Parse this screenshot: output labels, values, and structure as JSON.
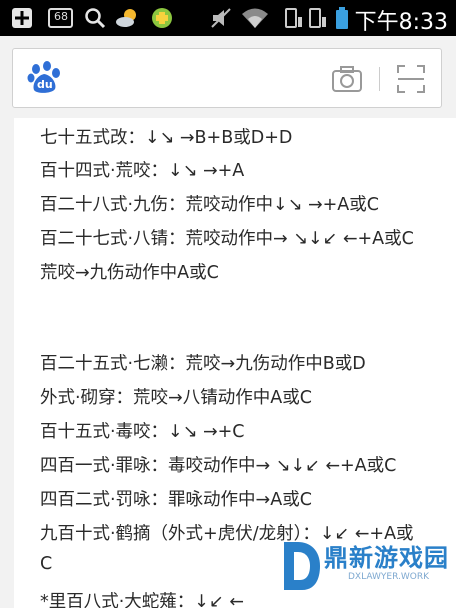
{
  "status_bar": {
    "time": "下午8:33",
    "notification_count": "68",
    "icons": [
      "add-icon",
      "notification-icon",
      "search-icon",
      "weather-icon",
      "game-icon",
      "mute-icon",
      "wifi-icon",
      "signal-1-icon",
      "signal-2-icon",
      "battery-icon"
    ]
  },
  "search_bar": {
    "logo": "baidu-logo",
    "logo_text": "du",
    "icons": [
      "camera-icon",
      "scan-icon"
    ]
  },
  "article": {
    "lines": [
      "七十五式改：↓↘ →B+B或D+D",
      "百十四式·荒咬：↓↘ →+A",
      "百二十八式·九伤：荒咬动作中↓↘ →+A或C",
      "百二十七式·八锖：荒咬动作中→ ↘↓↙ ←+A或C",
      "荒咬→九伤动作中A或C",
      "",
      "",
      "百二十五式·七濑：荒咬→九伤动作中B或D",
      "外式·砌穿：荒咬→八锖动作中A或C",
      "百十五式·毒咬：↓↘ →+C",
      "四百一式·罪咏：毒咬动作中→ ↘↓↙ ←+A或C",
      "四百二式·罚咏：罪咏动作中→A或C",
      "九百十式·鹤摘（外式+虎伏/龙射）：↓↙ ←+A或",
      "C",
      "*里百八式·大蛇薙：↓↙ ←"
    ]
  },
  "watermark": {
    "brand": "鼎新游戏园",
    "sub": "DXLAWYER.WORK"
  },
  "colors": {
    "status_bg": "#000000",
    "page_bg": "#f2f2f2",
    "baidu_blue": "#2f6fd6",
    "watermark_blue": "#2a80c9",
    "battery_blue": "#3aa0e0"
  }
}
